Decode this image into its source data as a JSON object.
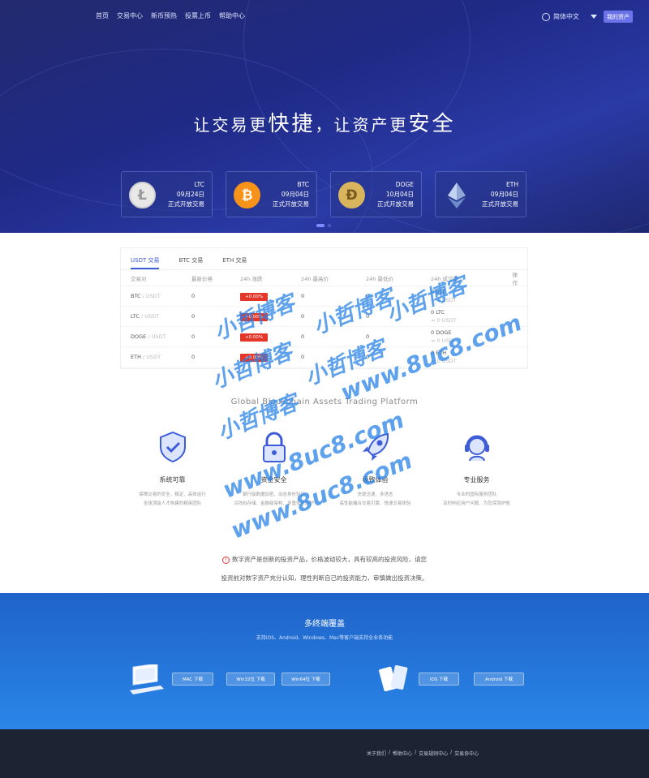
{
  "nav": {
    "items": [
      "首页",
      "交易中心",
      "新币预热",
      "投票上币",
      "帮助中心"
    ]
  },
  "header": {
    "language": "简体中文",
    "asset_button": "我的资产"
  },
  "hero": {
    "slogan_a": "让交易更",
    "slogan_b": "快捷",
    "slogan_c": "，让资产更",
    "slogan_d": "安全"
  },
  "coins": [
    {
      "symbol": "LTC",
      "date": "09月24日",
      "status": "正式开放交易",
      "icon": "litecoin-icon"
    },
    {
      "symbol": "BTC",
      "date": "09月04日",
      "status": "正式开放交易",
      "icon": "bitcoin-icon"
    },
    {
      "symbol": "DOGE",
      "date": "10月04日",
      "status": "正式开放交易",
      "icon": "dogecoin-icon"
    },
    {
      "symbol": "ETH",
      "date": "09月04日",
      "status": "正式开放交易",
      "icon": "ethereum-icon"
    }
  ],
  "market": {
    "tabs": [
      "USDT 交易",
      "BTC 交易",
      "ETH 交易"
    ],
    "headers": [
      "交易对",
      "最新价格",
      "24h 涨跌",
      "24h 最高价",
      "24h 最低价",
      "24h 成交量",
      "操作"
    ],
    "rows": [
      {
        "pair": "BTC",
        "quote": "/ USDT",
        "price": "0",
        "change": "+0.00%",
        "high": "0",
        "low": "0",
        "vol": "0 BTC",
        "vol2": "≈ 0 USDT"
      },
      {
        "pair": "LTC",
        "quote": "/ USDT",
        "price": "0",
        "change": "+0.00%",
        "high": "0",
        "low": "0",
        "vol": "0 LTC",
        "vol2": "≈ 0 USDT"
      },
      {
        "pair": "DOGE",
        "quote": "/ USDT",
        "price": "0",
        "change": "+0.00%",
        "high": "0",
        "low": "0",
        "vol": "0 DOGE",
        "vol2": "≈ 0 USDT"
      },
      {
        "pair": "ETH",
        "quote": "/ USDT",
        "price": "0",
        "change": "+0.00%",
        "high": "0",
        "low": "0",
        "vol": "0 ETH",
        "vol2": "≈ 0 USDT"
      }
    ]
  },
  "platform_title": "Global Blockchain Assets Trading Platform",
  "features": [
    {
      "title": "系统可靠",
      "line1": "保障交易的安全、稳定、高效运行",
      "line2": "全球顶级人才构建的精英团队",
      "icon": "shield-check-icon"
    },
    {
      "title": "资金安全",
      "line1": "银行级数据加密、动态身份验证",
      "line2": "冷钱包存储、金融级架构、多重安全防护",
      "icon": "lock-icon"
    },
    {
      "title": "极致体验",
      "line1": "充提迅速、多语言",
      "line2": "高性能撮合交易引擎、快速交易体验",
      "icon": "rocket-icon"
    },
    {
      "title": "专业服务",
      "line1": "专业的国际服务团队",
      "line2": "及时响应用户问题、为您保驾护航",
      "icon": "headset-icon"
    }
  ],
  "risk": {
    "line1": "数字资产是创新的投资产品，价格波动较大，具有较高的投资风险，请您",
    "line2": "投资前对数字资产充分认知，理性判断自己的投资能力，审慎做出投资决策。"
  },
  "multi": {
    "title": "多终端覆盖",
    "subtitle": "支持iOS、Android、Windows、Mac等客户端支持全业务功能",
    "buttons": [
      "MAC 下载",
      "Win32位 下载",
      "Win64位 下载",
      "IOS 下载",
      "Android 下载"
    ]
  },
  "footer": {
    "links": [
      "关于我们",
      "/",
      "帮助中心",
      "/",
      "交易规则中心",
      "/",
      "交易协中心"
    ]
  },
  "watermark": {
    "a": "小哲博客",
    "b": "www.8uc8.com"
  },
  "colors": {
    "hero": "#232a6e",
    "accent": "#3d5cd8",
    "down": "#e5362a",
    "band": "#2a86e8",
    "footer": "#1c2333"
  }
}
